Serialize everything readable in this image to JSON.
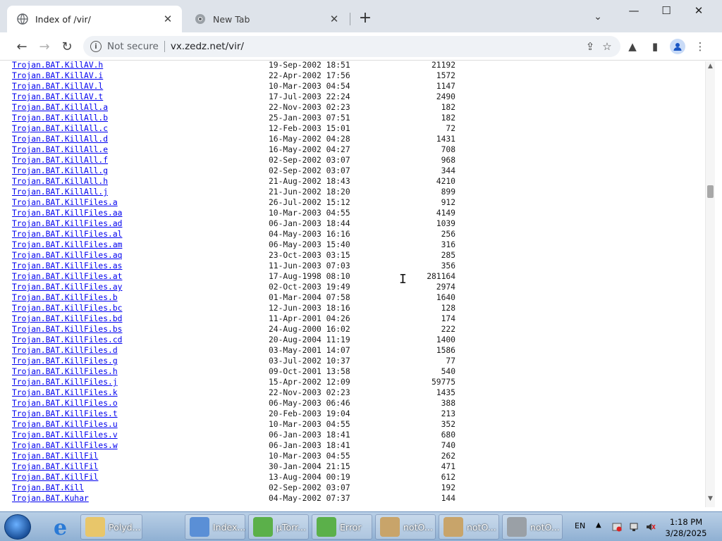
{
  "tabs": [
    {
      "title": "Index of /vir/",
      "active": true
    },
    {
      "title": "New Tab",
      "active": false
    }
  ],
  "toolbar": {
    "security_label": "Not secure",
    "url": "vx.zedz.net/vir/"
  },
  "listing": [
    {
      "name": "Trojan.BAT.KillAV.h",
      "date": "19-Sep-2002 18:51",
      "size": "21192"
    },
    {
      "name": "Trojan.BAT.KillAV.i",
      "date": "22-Apr-2002 17:56",
      "size": "1572"
    },
    {
      "name": "Trojan.BAT.KillAV.l",
      "date": "10-Mar-2003 04:54",
      "size": "1147"
    },
    {
      "name": "Trojan.BAT.KillAV.t",
      "date": "17-Jul-2003 22:24",
      "size": "2490"
    },
    {
      "name": "Trojan.BAT.KillAll.a",
      "date": "22-Nov-2003 02:23",
      "size": "182"
    },
    {
      "name": "Trojan.BAT.KillAll.b",
      "date": "25-Jan-2003 07:51",
      "size": "182"
    },
    {
      "name": "Trojan.BAT.KillAll.c",
      "date": "12-Feb-2003 15:01",
      "size": "72"
    },
    {
      "name": "Trojan.BAT.KillAll.d",
      "date": "16-May-2002 04:28",
      "size": "1431"
    },
    {
      "name": "Trojan.BAT.KillAll.e",
      "date": "16-May-2002 04:27",
      "size": "708"
    },
    {
      "name": "Trojan.BAT.KillAll.f",
      "date": "02-Sep-2002 03:07",
      "size": "968"
    },
    {
      "name": "Trojan.BAT.KillAll.g",
      "date": "02-Sep-2002 03:07",
      "size": "344"
    },
    {
      "name": "Trojan.BAT.KillAll.h",
      "date": "21-Aug-2002 18:43",
      "size": "4210"
    },
    {
      "name": "Trojan.BAT.KillAll.j",
      "date": "21-Jun-2002 18:20",
      "size": "899"
    },
    {
      "name": "Trojan.BAT.KillFiles.a",
      "date": "26-Jul-2002 15:12",
      "size": "912"
    },
    {
      "name": "Trojan.BAT.KillFiles.aa",
      "date": "10-Mar-2003 04:55",
      "size": "4149"
    },
    {
      "name": "Trojan.BAT.KillFiles.ad",
      "date": "06-Jan-2003 18:44",
      "size": "1039"
    },
    {
      "name": "Trojan.BAT.KillFiles.al",
      "date": "04-May-2003 16:16",
      "size": "256"
    },
    {
      "name": "Trojan.BAT.KillFiles.am",
      "date": "06-May-2003 15:40",
      "size": "316"
    },
    {
      "name": "Trojan.BAT.KillFiles.aq",
      "date": "23-Oct-2003 03:15",
      "size": "285"
    },
    {
      "name": "Trojan.BAT.KillFiles.as",
      "date": "11-Jun-2003 07:03",
      "size": "356"
    },
    {
      "name": "Trojan.BAT.KillFiles.at",
      "date": "17-Aug-1998 08:10",
      "size": "281164"
    },
    {
      "name": "Trojan.BAT.KillFiles.ay",
      "date": "02-Oct-2003 19:49",
      "size": "2974"
    },
    {
      "name": "Trojan.BAT.KillFiles.b",
      "date": "01-Mar-2004 07:58",
      "size": "1640"
    },
    {
      "name": "Trojan.BAT.KillFiles.bc",
      "date": "12-Jun-2003 18:16",
      "size": "128"
    },
    {
      "name": "Trojan.BAT.KillFiles.bd",
      "date": "11-Apr-2001 04:26",
      "size": "174"
    },
    {
      "name": "Trojan.BAT.KillFiles.bs",
      "date": "24-Aug-2000 16:02",
      "size": "222"
    },
    {
      "name": "Trojan.BAT.KillFiles.cd",
      "date": "20-Aug-2004 11:19",
      "size": "1400"
    },
    {
      "name": "Trojan.BAT.KillFiles.d",
      "date": "03-May-2001 14:07",
      "size": "1586"
    },
    {
      "name": "Trojan.BAT.KillFiles.g",
      "date": "03-Jul-2002 10:37",
      "size": "77"
    },
    {
      "name": "Trojan.BAT.KillFiles.h",
      "date": "09-Oct-2001 13:58",
      "size": "540"
    },
    {
      "name": "Trojan.BAT.KillFiles.j",
      "date": "15-Apr-2002 12:09",
      "size": "59775"
    },
    {
      "name": "Trojan.BAT.KillFiles.k",
      "date": "22-Nov-2003 02:23",
      "size": "1435"
    },
    {
      "name": "Trojan.BAT.KillFiles.o",
      "date": "06-May-2003 06:46",
      "size": "388"
    },
    {
      "name": "Trojan.BAT.KillFiles.t",
      "date": "20-Feb-2003 19:04",
      "size": "213"
    },
    {
      "name": "Trojan.BAT.KillFiles.u",
      "date": "10-Mar-2003 04:55",
      "size": "352"
    },
    {
      "name": "Trojan.BAT.KillFiles.v",
      "date": "06-Jan-2003 18:41",
      "size": "680"
    },
    {
      "name": "Trojan.BAT.KillFiles.w",
      "date": "06-Jan-2003 18:41",
      "size": "740"
    },
    {
      "name": "Trojan.BAT.KillFil",
      "date": "10-Mar-2003 04:55",
      "size": "262"
    },
    {
      "name": "Trojan.BAT.KillFil",
      "date": "30-Jan-2004 21:15",
      "size": "471"
    },
    {
      "name": "Trojan.BAT.KillFil",
      "date": "13-Aug-2004 00:19",
      "size": "612"
    },
    {
      "name": "Trojan.BAT.Kill",
      "date": "02-Sep-2002 03:07",
      "size": "192"
    },
    {
      "name": "Trojan.BAT.Kuhar",
      "date": "04-May-2002 07:37",
      "size": "144"
    }
  ],
  "taskbar": {
    "items": [
      {
        "label": "Polyd...",
        "icon": "folder-icon"
      },
      {
        "label": "Index...",
        "icon": "chrome-icon"
      },
      {
        "label": "µTorr...",
        "icon": "utorrent-icon"
      },
      {
        "label": "Error",
        "icon": "utorrent-icon"
      },
      {
        "label": "notO...",
        "icon": "package-icon"
      },
      {
        "label": "notO...",
        "icon": "package-icon"
      },
      {
        "label": "notO...",
        "icon": "tool-icon"
      }
    ],
    "language": "EN",
    "time": "1:18 PM",
    "date": "3/28/2025"
  },
  "colors": {
    "link": "#0000ee",
    "tabstrip": "#dee3ea",
    "omnibox": "#eff2f6"
  }
}
